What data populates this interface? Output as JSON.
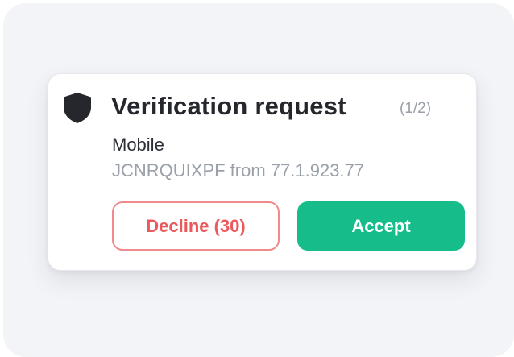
{
  "notification": {
    "title": "Verification request",
    "counter": "(1/2)",
    "device": "Mobile",
    "detail": "JCNRQUIXPF from 77.1.923.77",
    "icon": "shield-icon",
    "decline_label": "Decline (30)",
    "accept_label": "Accept"
  },
  "colors": {
    "accept": "#16bd8a",
    "decline_border": "#f08a8c",
    "decline_text": "#ea5a5d",
    "backdrop": "#f3f4f7"
  }
}
